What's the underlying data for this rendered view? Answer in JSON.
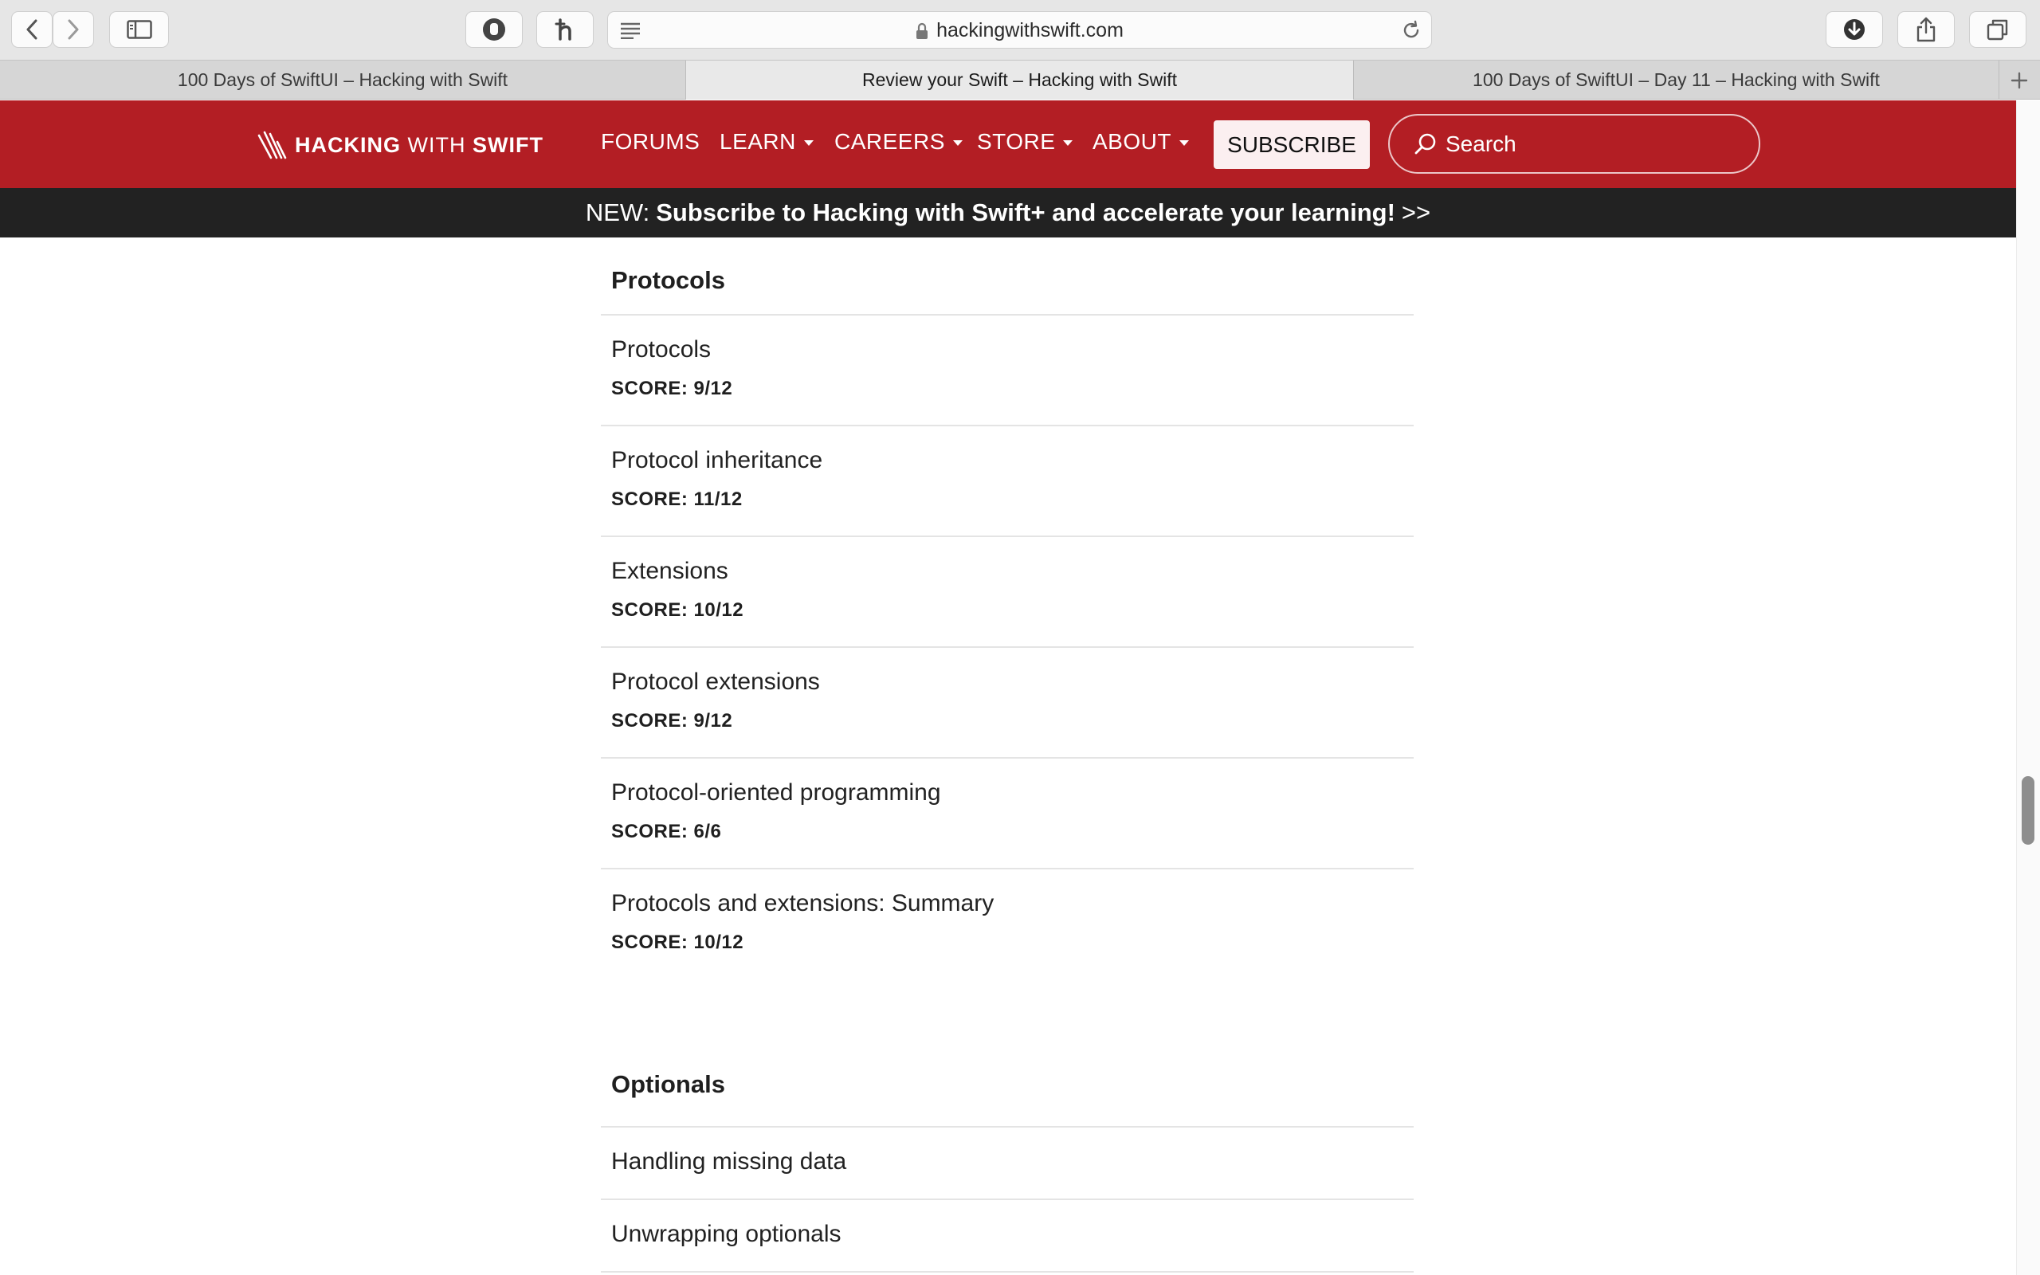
{
  "browser": {
    "url": "hackingwithswift.com",
    "tabs": [
      {
        "label": "100 Days of SwiftUI – Hacking with Swift",
        "active": false
      },
      {
        "label": "Review your Swift – Hacking with Swift",
        "active": true
      },
      {
        "label": "100 Days of SwiftUI – Day 11 – Hacking with Swift",
        "active": false
      }
    ]
  },
  "site": {
    "logo_part1": "HACKING",
    "logo_part2": "WITH",
    "logo_part3": "SWIFT",
    "nav": {
      "forums": "FORUMS",
      "learn": "LEARN",
      "careers": "CAREERS",
      "store": "STORE",
      "about": "ABOUT"
    },
    "subscribe_label": "SUBSCRIBE",
    "search_placeholder": "Search",
    "colors": {
      "brand_red": "#b31e24",
      "banner_dark": "#222222"
    }
  },
  "promo": {
    "prefix": "NEW:",
    "message": "Subscribe to Hacking with Swift+ and accelerate your learning!",
    "arrows": ">>"
  },
  "sections": [
    {
      "title": "Protocols",
      "items": [
        {
          "name": "Protocols",
          "score": "SCORE: 9/12"
        },
        {
          "name": "Protocol inheritance",
          "score": "SCORE: 11/12"
        },
        {
          "name": "Extensions",
          "score": "SCORE: 10/12"
        },
        {
          "name": "Protocol extensions",
          "score": "SCORE: 9/12"
        },
        {
          "name": "Protocol-oriented programming",
          "score": "SCORE: 6/6"
        },
        {
          "name": "Protocols and extensions: Summary",
          "score": "SCORE: 10/12"
        }
      ]
    },
    {
      "title": "Optionals",
      "items": [
        {
          "name": "Handling missing data"
        },
        {
          "name": "Unwrapping optionals"
        }
      ]
    }
  ]
}
